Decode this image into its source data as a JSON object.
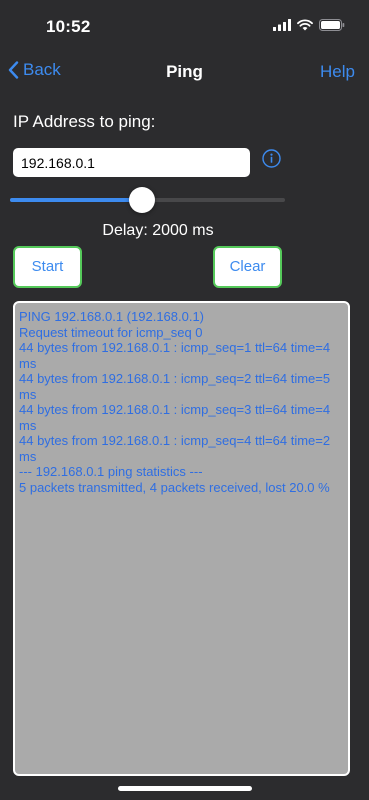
{
  "status_bar": {
    "time": "10:52"
  },
  "nav": {
    "back_label": "Back",
    "title": "Ping",
    "help_label": "Help"
  },
  "form": {
    "ip_label": "IP Address to ping:",
    "ip_value": "192.168.0.1",
    "slider_fraction": 0.48,
    "delay_text": "Delay: 2000 ms"
  },
  "buttons": {
    "start_label": "Start",
    "clear_label": "Clear"
  },
  "output": {
    "lines": [
      "PING 192.168.0.1 (192.168.0.1)",
      "Request timeout for icmp_seq 0",
      "44 bytes from 192.168.0.1 : icmp_seq=1 ttl=64 time=4 ms",
      "44 bytes from 192.168.0.1 : icmp_seq=2 ttl=64 time=5 ms",
      "44 bytes from 192.168.0.1 : icmp_seq=3 ttl=64 time=4 ms",
      "44 bytes from 192.168.0.1 : icmp_seq=4 ttl=64 time=2 ms",
      "--- 192.168.0.1 ping statistics ---",
      "5 packets transmitted, 4 packets received, lost 20.0 %"
    ]
  },
  "colors": {
    "accent": "#3d8bef",
    "button_border": "#55c95a",
    "background": "#2c2c2e",
    "output_bg": "#aaaaaa",
    "output_text": "#2f6ee2"
  },
  "icons": [
    "cellular-signal-icon",
    "wifi-icon",
    "battery-icon",
    "chevron-left-icon",
    "info-icon"
  ]
}
